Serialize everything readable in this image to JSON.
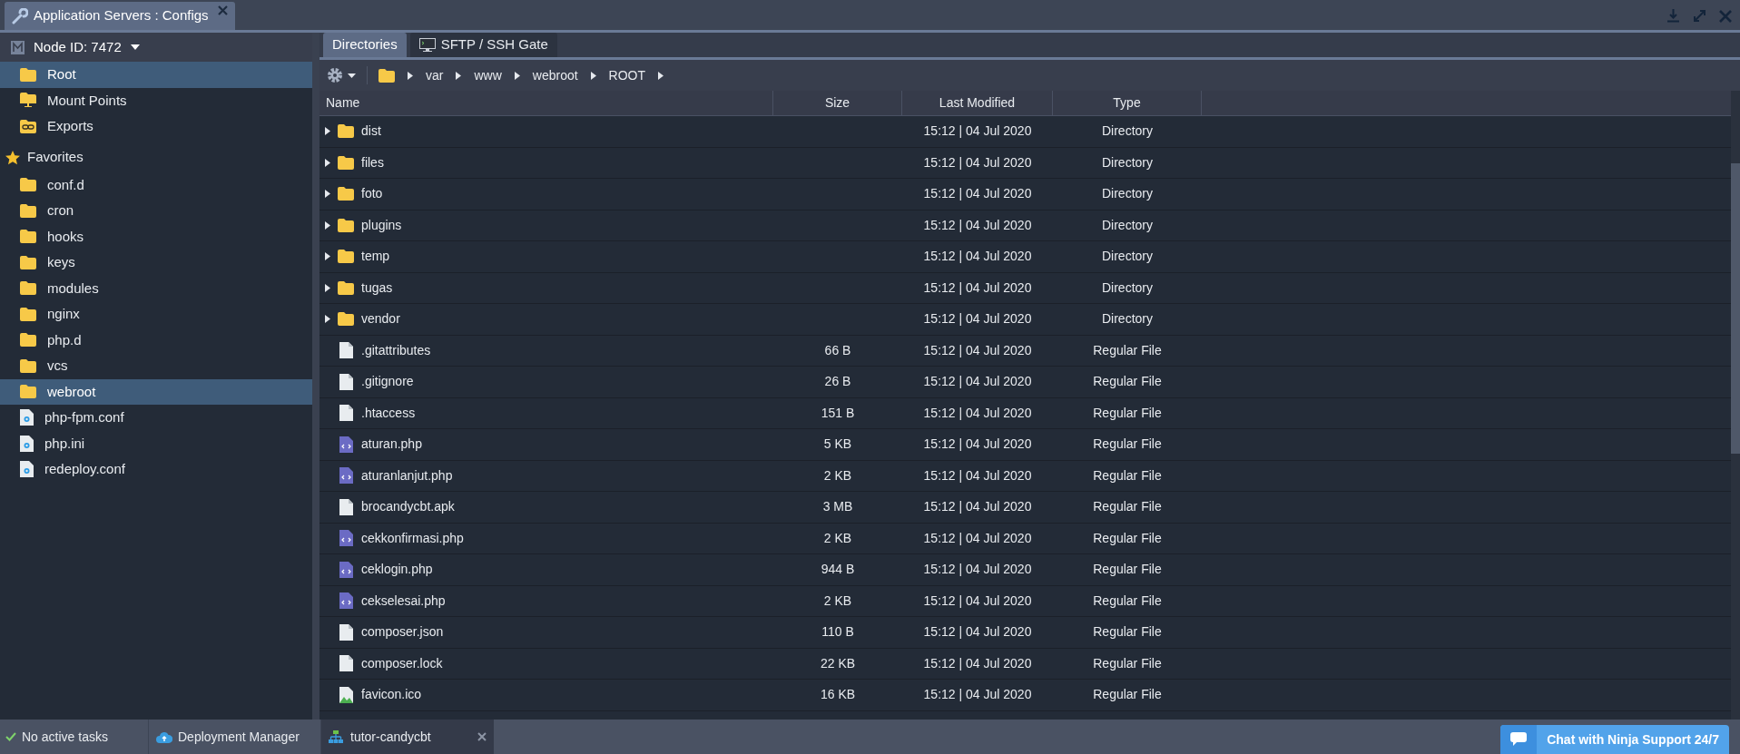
{
  "window": {
    "title": "Application Servers : Configs"
  },
  "sidebar": {
    "node": "Node ID: 7472",
    "top_items": [
      {
        "label": "Root",
        "kind": "folder",
        "selected": true
      },
      {
        "label": "Mount Points",
        "kind": "mount",
        "selected": false
      },
      {
        "label": "Exports",
        "kind": "export",
        "selected": false
      }
    ],
    "favorites_label": "Favorites",
    "favorites": [
      {
        "label": "conf.d",
        "kind": "folder",
        "selected": false
      },
      {
        "label": "cron",
        "kind": "folder",
        "selected": false
      },
      {
        "label": "hooks",
        "kind": "folder",
        "selected": false
      },
      {
        "label": "keys",
        "kind": "folder",
        "selected": false
      },
      {
        "label": "modules",
        "kind": "folder",
        "selected": false
      },
      {
        "label": "nginx",
        "kind": "folder",
        "selected": false
      },
      {
        "label": "php.d",
        "kind": "folder",
        "selected": false
      },
      {
        "label": "vcs",
        "kind": "folder",
        "selected": false
      },
      {
        "label": "webroot",
        "kind": "folder",
        "selected": true
      },
      {
        "label": "php-fpm.conf",
        "kind": "config",
        "selected": false
      },
      {
        "label": "php.ini",
        "kind": "config",
        "selected": false
      },
      {
        "label": "redeploy.conf",
        "kind": "config",
        "selected": false
      }
    ]
  },
  "tabs": [
    {
      "label": "Directories",
      "selected": true
    },
    {
      "label": "SFTP / SSH Gate",
      "selected": false
    }
  ],
  "breadcrumb": [
    "var",
    "www",
    "webroot",
    "ROOT"
  ],
  "table": {
    "columns": [
      "Name",
      "Size",
      "Last Modified",
      "Type"
    ],
    "rows": [
      {
        "kind": "dir",
        "name": "dist",
        "modified": "15:12 | 04 Jul 2020",
        "type": "Directory"
      },
      {
        "kind": "dir",
        "name": "files",
        "modified": "15:12 | 04 Jul 2020",
        "type": "Directory"
      },
      {
        "kind": "dir",
        "name": "foto",
        "modified": "15:12 | 04 Jul 2020",
        "type": "Directory"
      },
      {
        "kind": "dir",
        "name": "plugins",
        "modified": "15:12 | 04 Jul 2020",
        "type": "Directory"
      },
      {
        "kind": "dir",
        "name": "temp",
        "modified": "15:12 | 04 Jul 2020",
        "type": "Directory"
      },
      {
        "kind": "dir",
        "name": "tugas",
        "modified": "15:12 | 04 Jul 2020",
        "type": "Directory"
      },
      {
        "kind": "dir",
        "name": "vendor",
        "modified": "15:12 | 04 Jul 2020",
        "type": "Directory"
      },
      {
        "kind": "file",
        "name": ".gitattributes",
        "size": "66 B",
        "modified": "15:12 | 04 Jul 2020",
        "type": "Regular File"
      },
      {
        "kind": "file",
        "name": ".gitignore",
        "size": "26 B",
        "modified": "15:12 | 04 Jul 2020",
        "type": "Regular File"
      },
      {
        "kind": "file",
        "name": ".htaccess",
        "size": "151 B",
        "modified": "15:12 | 04 Jul 2020",
        "type": "Regular File"
      },
      {
        "kind": "php",
        "name": "aturan.php",
        "size": "5 KB",
        "modified": "15:12 | 04 Jul 2020",
        "type": "Regular File"
      },
      {
        "kind": "php",
        "name": "aturanlanjut.php",
        "size": "2 KB",
        "modified": "15:12 | 04 Jul 2020",
        "type": "Regular File"
      },
      {
        "kind": "file",
        "name": "brocandycbt.apk",
        "size": "3 MB",
        "modified": "15:12 | 04 Jul 2020",
        "type": "Regular File"
      },
      {
        "kind": "php",
        "name": "cekkonfirmasi.php",
        "size": "2 KB",
        "modified": "15:12 | 04 Jul 2020",
        "type": "Regular File"
      },
      {
        "kind": "php",
        "name": "ceklogin.php",
        "size": "944 B",
        "modified": "15:12 | 04 Jul 2020",
        "type": "Regular File"
      },
      {
        "kind": "php",
        "name": "cekselesai.php",
        "size": "2 KB",
        "modified": "15:12 | 04 Jul 2020",
        "type": "Regular File"
      },
      {
        "kind": "file",
        "name": "composer.json",
        "size": "110 B",
        "modified": "15:12 | 04 Jul 2020",
        "type": "Regular File"
      },
      {
        "kind": "file",
        "name": "composer.lock",
        "size": "22 KB",
        "modified": "15:12 | 04 Jul 2020",
        "type": "Regular File"
      },
      {
        "kind": "image",
        "name": "favicon.ico",
        "size": "16 KB",
        "modified": "15:12 | 04 Jul 2020",
        "type": "Regular File"
      }
    ]
  },
  "status_bar": {
    "tasks": "No active tasks",
    "deployment": "Deployment Manager",
    "env": "tutor-candycbt",
    "chat": "Chat with Ninja Support 24/7"
  }
}
